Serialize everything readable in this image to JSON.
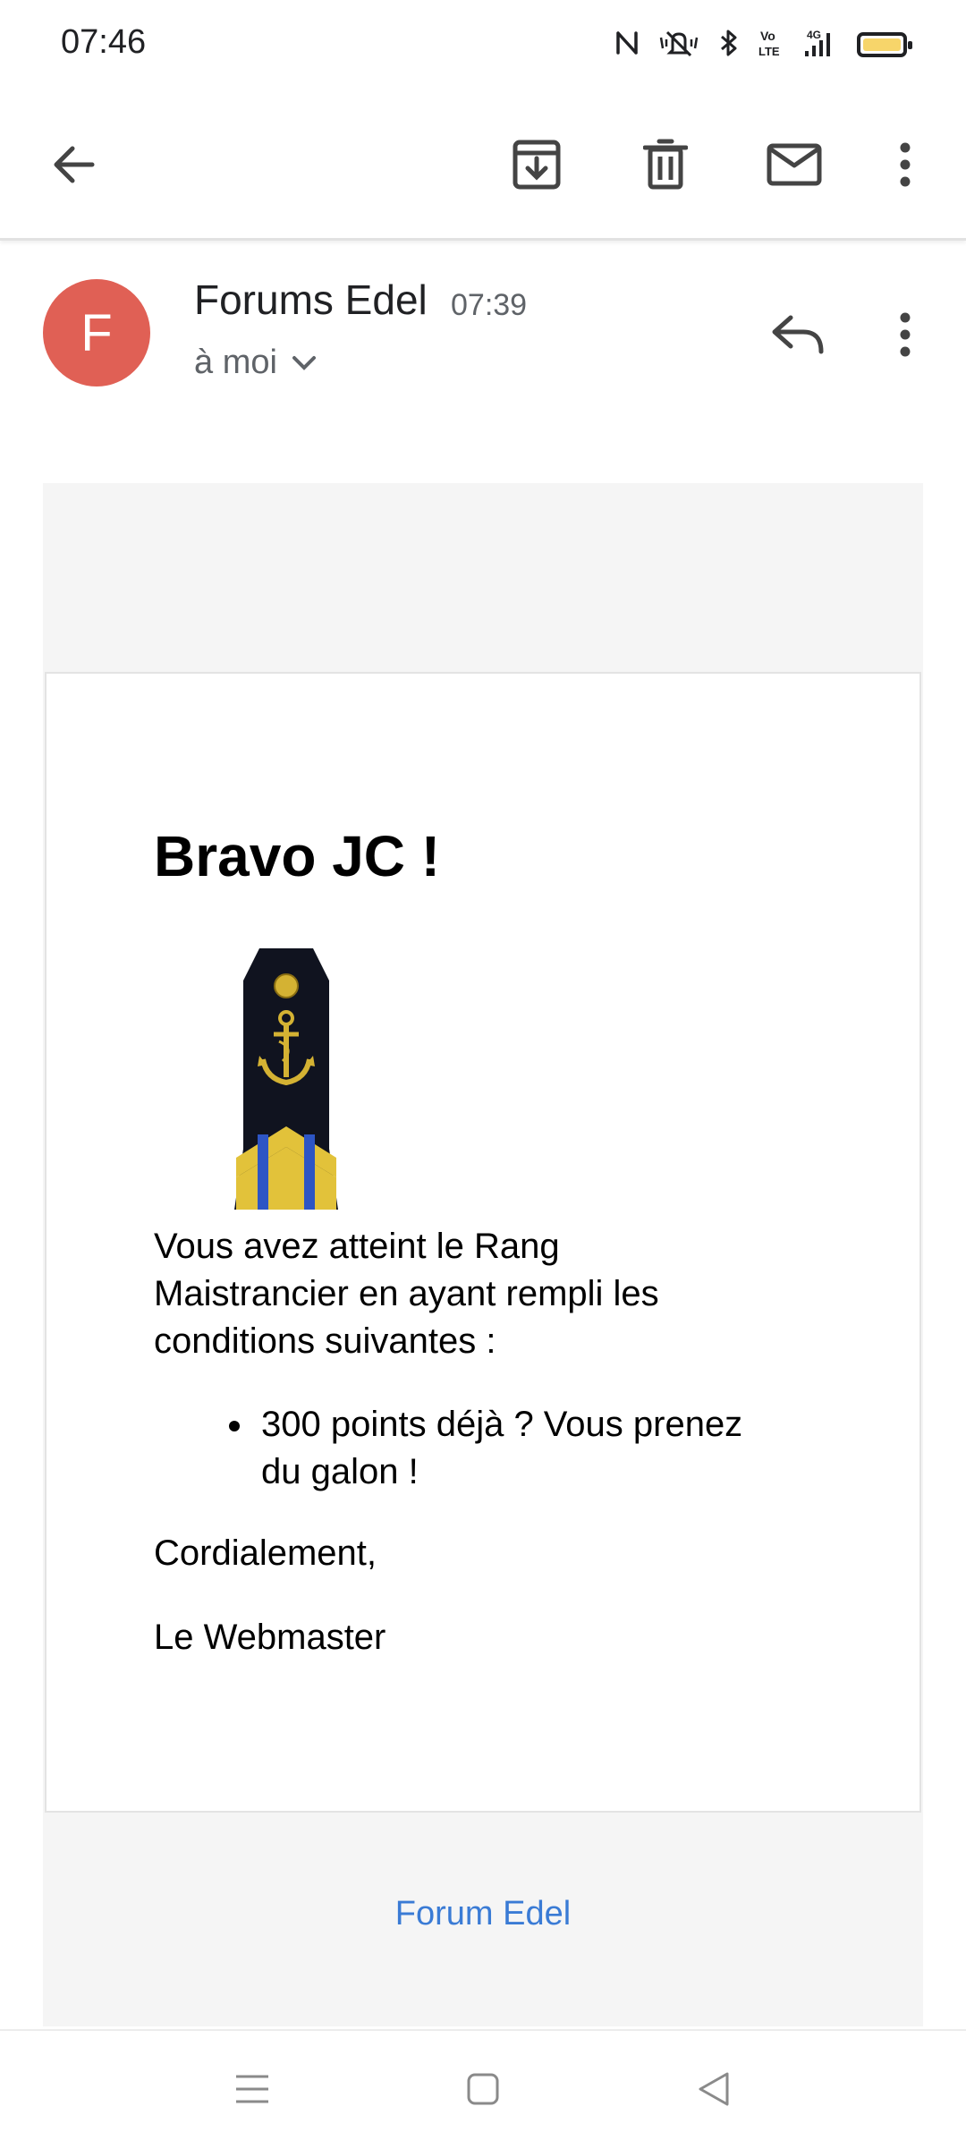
{
  "status_bar": {
    "time": "07:46",
    "icons": [
      "nfc-icon",
      "mute-icon",
      "bluetooth-icon",
      "volte-icon",
      "signal-4g-icon",
      "battery-icon"
    ],
    "network_label": "4G",
    "volte_label": "Vo LTE"
  },
  "app_bar": {
    "icons": [
      "back-arrow-icon",
      "archive-icon",
      "delete-icon",
      "mail-icon",
      "more-vert-icon"
    ]
  },
  "email": {
    "sender_initial": "F",
    "sender_name": "Forums Edel",
    "time": "07:39",
    "recipient": "à moi",
    "heading": "Bravo JC !",
    "body_line_1": "Vous avez atteint le Rang",
    "body_line_2": "Maistrancier en ayant rempli les",
    "body_line_3": "conditions suivantes :",
    "bullet_line_1": "300 points déjà ? Vous prenez",
    "bullet_line_2": "du galon !",
    "closing": "Cordialement,",
    "signature": "Le Webmaster",
    "footer_link": "Forum Edel"
  },
  "colors": {
    "avatar_bg": "#e06055",
    "link": "#3a7bd5",
    "frame_bg": "#f5f5f5",
    "battery": "#f7d56a"
  },
  "nav_bar": {
    "icons": [
      "menu-icon",
      "home-square-icon",
      "back-triangle-icon"
    ]
  }
}
